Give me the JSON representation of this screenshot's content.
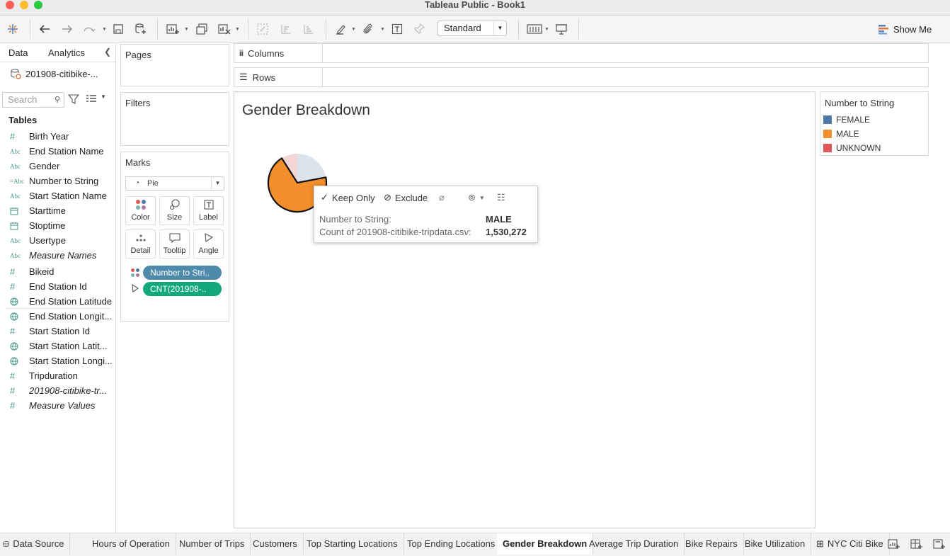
{
  "window": {
    "title": "Tableau Public - Book1"
  },
  "toolbar": {
    "fit_select": "Standard",
    "show_me_label": "Show Me"
  },
  "left_pane": {
    "tabs": {
      "data": "Data",
      "analytics": "Analytics"
    },
    "datasource": "201908-citibike-...",
    "search_placeholder": "Search",
    "tables_header": "Tables",
    "dimensions": [
      {
        "icon": "#",
        "name": "Birth Year"
      },
      {
        "icon": "Abc",
        "name": "End Station Name"
      },
      {
        "icon": "Abc",
        "name": "Gender"
      },
      {
        "icon": "=Abc",
        "name": "Number to String"
      },
      {
        "icon": "Abc",
        "name": "Start Station Name"
      },
      {
        "icon": "calendar",
        "name": "Starttime"
      },
      {
        "icon": "calendar",
        "name": "Stoptime"
      },
      {
        "icon": "Abc",
        "name": "Usertype"
      },
      {
        "icon": "Abc",
        "name": "Measure Names"
      }
    ],
    "measures": [
      {
        "icon": "#",
        "name": "Bikeid"
      },
      {
        "icon": "#",
        "name": "End Station Id"
      },
      {
        "icon": "globe",
        "name": "End Station Latitude"
      },
      {
        "icon": "globe",
        "name": "End Station Longit..."
      },
      {
        "icon": "#",
        "name": "Start Station Id"
      },
      {
        "icon": "globe",
        "name": "Start Station Latit..."
      },
      {
        "icon": "globe",
        "name": "Start Station Longi..."
      },
      {
        "icon": "#",
        "name": "Tripduration"
      },
      {
        "icon": "#",
        "name": "201908-citibike-tr..."
      },
      {
        "icon": "#",
        "name": "Measure Values"
      }
    ]
  },
  "cards": {
    "pages": "Pages",
    "filters": "Filters",
    "marks": "Marks",
    "mark_type": "Pie",
    "buttons": {
      "color": "Color",
      "size": "Size",
      "label": "Label",
      "detail": "Detail",
      "tooltip": "Tooltip",
      "angle": "Angle"
    },
    "pills": {
      "color_pill": "Number to Stri..",
      "angle_pill": "CNT(201908-.."
    },
    "colors": {
      "color_pill": "#4e8aa9",
      "angle_pill": "#13a87c"
    }
  },
  "shelves": {
    "columns": "Columns",
    "rows": "Rows"
  },
  "view": {
    "title": "Gender Breakdown"
  },
  "chart_data": {
    "type": "pie",
    "title": "Gender Breakdown",
    "categories": [
      "FEMALE",
      "MALE",
      "UNKNOWN"
    ],
    "values": [
      0.22,
      0.69,
      0.09
    ],
    "colors": [
      "#4e79a7",
      "#f28e2b",
      "#e15759"
    ],
    "highlighted": "MALE",
    "highlighted_count": "1,530,272"
  },
  "legend": {
    "title": "Number to String",
    "items": [
      {
        "label": "FEMALE",
        "color": "#4e79a7"
      },
      {
        "label": "MALE",
        "color": "#f28e2b"
      },
      {
        "label": "UNKNOWN",
        "color": "#e15759"
      }
    ]
  },
  "tooltip": {
    "keep_only": "Keep Only",
    "exclude": "Exclude",
    "field1_key": "Number to String:",
    "field1_val": "MALE",
    "field2_key": "Count of 201908-citibike-tripdata.csv:",
    "field2_val": "1,530,272"
  },
  "sheet_tabs": {
    "data_source": "Data Source",
    "tabs": [
      "Hours of Operation",
      "Number of Trips",
      "Customers",
      "Top Starting Locations",
      "Top Ending Locations",
      "Gender Breakdown",
      "Average Trip Duration",
      "Bike Repairs",
      "Bike Utilization"
    ],
    "active": "Gender Breakdown",
    "story": "NYC Citi Bike"
  }
}
